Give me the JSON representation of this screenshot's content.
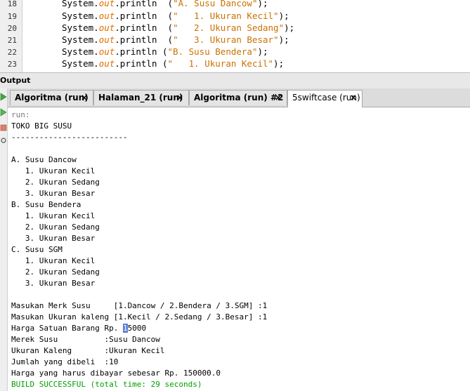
{
  "editor": {
    "lines": [
      {
        "num": "18",
        "prefix": "System.",
        "method": "out",
        "call": ".println  (",
        "literal": "\"A. Susu Dancow\"",
        "suffix": ");"
      },
      {
        "num": "19",
        "prefix": "System.",
        "method": "out",
        "call": ".println  (",
        "literal": "\"   1. Ukuran Kecil\"",
        "suffix": ");"
      },
      {
        "num": "20",
        "prefix": "System.",
        "method": "out",
        "call": ".println  (",
        "literal": "\"   2. Ukuran Sedang\"",
        "suffix": ");"
      },
      {
        "num": "21",
        "prefix": "System.",
        "method": "out",
        "call": ".println  (",
        "literal": "\"   3. Ukuran Besar\"",
        "suffix": ");"
      },
      {
        "num": "22",
        "prefix": "System.",
        "method": "out",
        "call": ".println (",
        "literal": "\"B. Susu Bendera\"",
        "suffix": ");"
      },
      {
        "num": "23",
        "prefix": "System.",
        "method": "out",
        "call": ".println (",
        "literal": "\"   1. Ukuran Kecil\"",
        "suffix": ");"
      }
    ]
  },
  "output_panel": {
    "title": "Output"
  },
  "tabs": [
    {
      "label": "Algoritma (run)",
      "close": "×"
    },
    {
      "label": "Halaman_21 (run)",
      "close": "×"
    },
    {
      "label": "Algoritma (run) #2",
      "close": "×"
    },
    {
      "label": "5swiftcase (run)",
      "close": "×"
    }
  ],
  "toolbar_icons": [
    "run-icon",
    "rerun-icon",
    "stop-icon",
    "settings-icon"
  ],
  "console": {
    "run_label": "run:",
    "lines": [
      "TOKO BIG SUSU",
      "-------------------------",
      "",
      "A. Susu Dancow",
      "   1. Ukuran Kecil",
      "   2. Ukuran Sedang",
      "   3. Ukuran Besar",
      "B. Susu Bendera",
      "   1. Ukuran Kecil",
      "   2. Ukuran Sedang",
      "   3. Ukuran Besar",
      "C. Susu SGM",
      "   1. Ukuran Kecil",
      "   2. Ukuran Sedang",
      "   3. Ukuran Besar",
      "",
      "Masukan Merk Susu     [1.Dancow / 2.Bendera / 3.SGM] :1",
      "Masukan Ukuran kaleng [1.Kecil / 2.Sedang / 3.Besar] :1"
    ],
    "price_prefix": "Harga Satuan Barang Rp. ",
    "price_cursor": "1",
    "price_rest": "5000",
    "lines_after": [
      "Merek Susu          :Susu Dancow",
      "Ukuran Kaleng       :Ukuran Kecil",
      "Jumlah yang dibeli  :10",
      "Harga yang harus dibayar sebesar Rp. 150000.0"
    ],
    "build": "BUILD SUCCESSFUL (total time: 29 seconds)"
  }
}
